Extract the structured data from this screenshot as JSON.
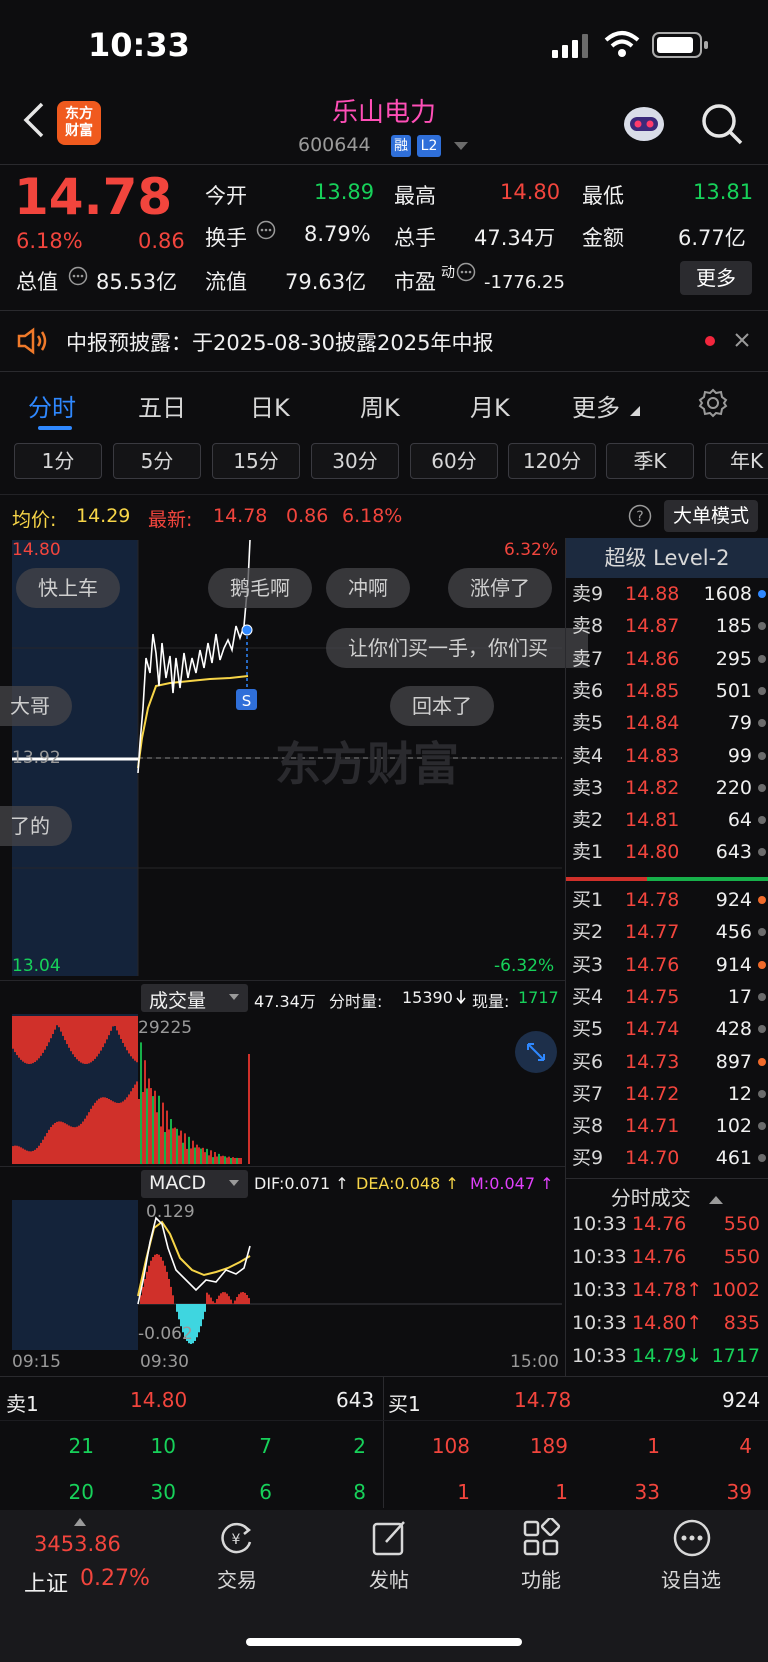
{
  "status_bar": {
    "time": "10:33"
  },
  "header": {
    "back_icon": "chevron-left-icon",
    "logo_text": "东方财富",
    "stock_name": "乐山电力",
    "stock_code": "600644",
    "tag_margin": "融",
    "tag_level": "L2"
  },
  "quote": {
    "price": "14.78",
    "change_pct": "6.18%",
    "change": "0.86",
    "open_label": "今开",
    "open": "13.89",
    "high_label": "最高",
    "high": "14.80",
    "low_label": "最低",
    "low": "13.81",
    "turnover_label": "换手",
    "turnover": "8.79%",
    "volume_label": "总手",
    "volume": "47.34万",
    "amount_label": "金额",
    "amount": "6.77亿",
    "market_cap_label": "总值",
    "market_cap": "85.53亿",
    "float_cap_label": "流值",
    "float_cap": "79.63亿",
    "pe_label": "市盈",
    "pe_sup": "动",
    "pe": "-1776.25",
    "more_button": "更多"
  },
  "notice": {
    "text": "中报预披露：于2025-08-30披露2025年中报"
  },
  "tabs": [
    "分时",
    "五日",
    "日K",
    "周K",
    "月K",
    "更多"
  ],
  "period_chips": [
    "1分",
    "5分",
    "15分",
    "30分",
    "60分",
    "120分",
    "季K",
    "年K"
  ],
  "chart_header": {
    "avg_label": "均价:",
    "avg": "14.29",
    "latest_label": "最新:",
    "latest": "14.78",
    "latest_change": "0.86",
    "latest_pct": "6.18%",
    "mode_button": "大单模式"
  },
  "intraday": {
    "y_top": "14.80",
    "y_bottom": "13.04",
    "pct_top": "6.32%",
    "pct_bottom": "-6.32%",
    "prev_close_label": "13.92",
    "watermark": "东方财富",
    "signal": "S"
  },
  "comments": [
    "快上车",
    "鹅毛啊",
    "冲啊",
    "涨停了",
    "让你们买一手，你们买",
    "大哥",
    "回本了",
    "了的"
  ],
  "volume_panel": {
    "label": "成交量",
    "total": "47.34万",
    "minute_label": "分时量:",
    "minute": "15390",
    "current_label": "现量:",
    "current": "1717",
    "max": "29225"
  },
  "macd_panel": {
    "label": "MACD",
    "dif": "DIF:0.071 ↑",
    "dea": "DEA:0.048 ↑",
    "m": "M:0.047 ↑",
    "top": "0.129",
    "bottom": "-0.062"
  },
  "time_axis": {
    "t1": "09:15",
    "t2": "09:30",
    "t3": "15:00"
  },
  "order_book_title": "超级 Level-2",
  "asks": [
    {
      "label": "卖9",
      "price": "14.88",
      "vol": "1608",
      "dot": "blue"
    },
    {
      "label": "卖8",
      "price": "14.87",
      "vol": "185",
      "dot": "gray"
    },
    {
      "label": "卖7",
      "price": "14.86",
      "vol": "295",
      "dot": "gray"
    },
    {
      "label": "卖6",
      "price": "14.85",
      "vol": "501",
      "dot": "gray"
    },
    {
      "label": "卖5",
      "price": "14.84",
      "vol": "79",
      "dot": "gray"
    },
    {
      "label": "卖4",
      "price": "14.83",
      "vol": "99",
      "dot": "gray"
    },
    {
      "label": "卖3",
      "price": "14.82",
      "vol": "220",
      "dot": "gray"
    },
    {
      "label": "卖2",
      "price": "14.81",
      "vol": "64",
      "dot": "gray"
    },
    {
      "label": "卖1",
      "price": "14.80",
      "vol": "643",
      "dot": "gray"
    }
  ],
  "bids": [
    {
      "label": "买1",
      "price": "14.78",
      "vol": "924",
      "dot": "orange"
    },
    {
      "label": "买2",
      "price": "14.77",
      "vol": "456",
      "dot": "gray"
    },
    {
      "label": "买3",
      "price": "14.76",
      "vol": "914",
      "dot": "orange"
    },
    {
      "label": "买4",
      "price": "14.75",
      "vol": "17",
      "dot": "gray"
    },
    {
      "label": "买5",
      "price": "14.74",
      "vol": "428",
      "dot": "gray"
    },
    {
      "label": "买6",
      "price": "14.73",
      "vol": "897",
      "dot": "orange"
    },
    {
      "label": "买7",
      "price": "14.72",
      "vol": "12",
      "dot": "gray"
    },
    {
      "label": "买8",
      "price": "14.71",
      "vol": "102",
      "dot": "gray"
    },
    {
      "label": "买9",
      "price": "14.70",
      "vol": "461",
      "dot": "gray"
    }
  ],
  "ticks_title": "分时成交",
  "ticks": [
    {
      "time": "10:33",
      "price": "14.76",
      "vol": "550"
    },
    {
      "time": "10:33",
      "price": "14.76",
      "vol": "550"
    },
    {
      "time": "10:33",
      "price": "14.78↑",
      "vol": "1002"
    },
    {
      "time": "10:33",
      "price": "14.80↑",
      "vol": "835"
    },
    {
      "time": "10:33",
      "price": "14.79↓",
      "vol": "1717"
    }
  ],
  "queue": {
    "sell_label": "卖1",
    "sell_price": "14.80",
    "sell_vol": "643",
    "buy_label": "买1",
    "buy_price": "14.78",
    "buy_vol": "924",
    "sell_row1": [
      "21",
      "10",
      "7",
      "2"
    ],
    "sell_row2": [
      "20",
      "30",
      "6",
      "8"
    ],
    "buy_row1": [
      "108",
      "189",
      "1",
      "4"
    ],
    "buy_row2": [
      "1",
      "1",
      "33",
      "39"
    ]
  },
  "bottom_nav": {
    "index_value": "3453.86",
    "index_name": "上证",
    "index_pct": "0.27%",
    "trade": "交易",
    "post": "发帖",
    "functions": "功能",
    "watchlist": "设自选"
  }
}
